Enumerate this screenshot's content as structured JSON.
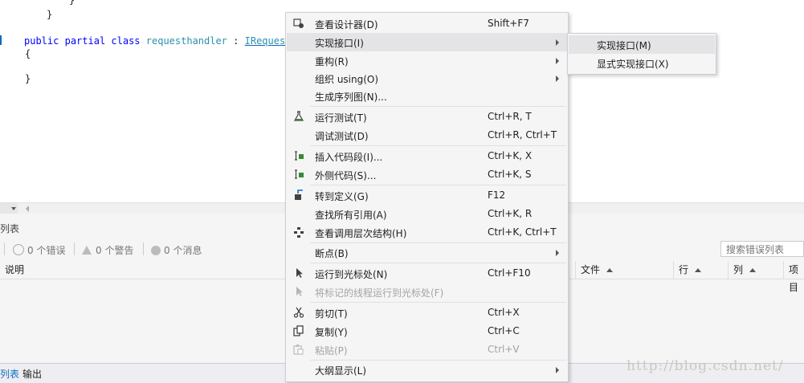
{
  "editor": {
    "lines": [
      "}",
      "}",
      "public partial class requesthandler : IRequest",
      "{",
      "}"
    ],
    "kw_public": "public",
    "kw_partial": "partial",
    "kw_class": "class",
    "class_name": "requesthandler",
    "colon": ":",
    "interface_partial": "IRequest"
  },
  "errors_panel": {
    "title": "列表",
    "errors": "0 个错误",
    "warnings": "0 个警告",
    "messages": "0 个消息",
    "search_placeholder": "搜索错误列表",
    "columns": [
      "说明",
      "文件",
      "行",
      "列",
      "项目"
    ]
  },
  "bottom_tabs": [
    "列表",
    "输出"
  ],
  "watermark": "http://blog.csdn.net/",
  "context_menu": [
    {
      "label": "查看设计器(D)",
      "shortcut": "Shift+F7",
      "icon": "designer-icon"
    },
    {
      "label": "实现接口(I)",
      "submenu": true,
      "highlighted": true
    },
    {
      "label": "重构(R)",
      "submenu": true
    },
    {
      "label": "组织 using(O)",
      "submenu": true
    },
    {
      "label": "生成序列图(N)..."
    },
    {
      "label": "运行测试(T)",
      "shortcut": "Ctrl+R, T",
      "icon": "flask-icon"
    },
    {
      "label": "调试测试(D)",
      "shortcut": "Ctrl+R, Ctrl+T"
    },
    {
      "label": "插入代码段(I)...",
      "shortcut": "Ctrl+K, X",
      "icon": "snippet-icon"
    },
    {
      "label": "外侧代码(S)...",
      "shortcut": "Ctrl+K, S",
      "icon": "surround-icon"
    },
    {
      "label": "转到定义(G)",
      "shortcut": "F12",
      "icon": "goto-definition-icon"
    },
    {
      "label": "查找所有引用(A)",
      "shortcut": "Ctrl+K, R"
    },
    {
      "label": "查看调用层次结构(H)",
      "shortcut": "Ctrl+K, Ctrl+T",
      "icon": "call-hierarchy-icon"
    },
    {
      "label": "断点(B)",
      "submenu": true
    },
    {
      "label": "运行到光标处(N)",
      "shortcut": "Ctrl+F10",
      "icon": "cursor-icon"
    },
    {
      "label": "将标记的线程运行到光标处(F)",
      "disabled": true,
      "icon": "cursor-icon"
    },
    {
      "label": "剪切(T)",
      "shortcut": "Ctrl+X",
      "icon": "scissors-icon"
    },
    {
      "label": "复制(Y)",
      "shortcut": "Ctrl+C",
      "icon": "copy-icon"
    },
    {
      "label": "粘贴(P)",
      "shortcut": "Ctrl+V",
      "disabled": true,
      "icon": "paste-icon"
    },
    {
      "label": "大纲显示(L)",
      "submenu": true
    }
  ],
  "submenu": [
    {
      "label": "实现接口(M)"
    },
    {
      "label": "显式实现接口(X)"
    }
  ]
}
